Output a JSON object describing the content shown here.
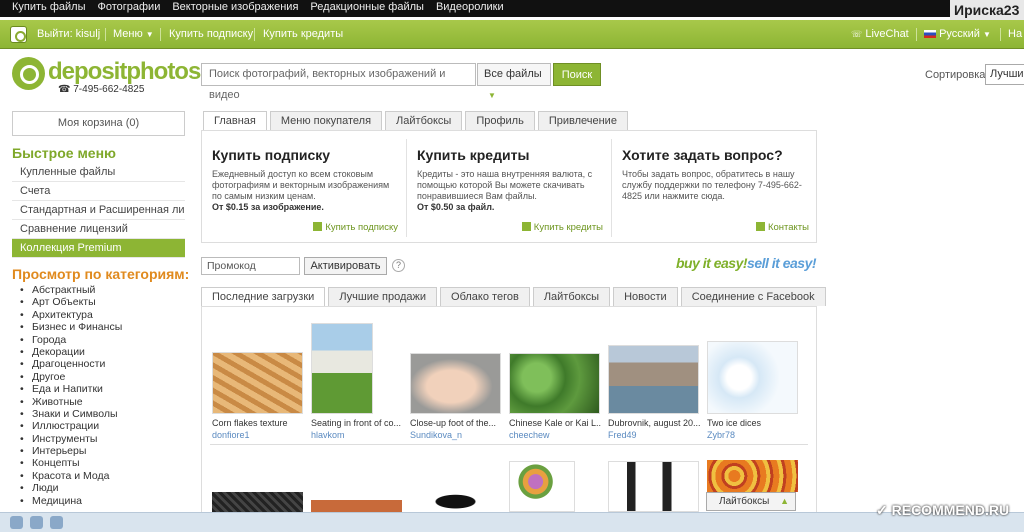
{
  "topnav": [
    "Купить файлы",
    "Фотографии",
    "Векторные изображения",
    "Редакционные файлы",
    "Видеоролики"
  ],
  "username_badge": "Ириска23",
  "greenbar": {
    "logout": "Выйти: kisulj",
    "menu": "Меню",
    "buy_sub": "Купить подписку",
    "buy_credits": "Купить кредиты",
    "livechat": "LiveChat",
    "language": "Русский",
    "next": "На"
  },
  "logo": {
    "text": "depositphotos",
    "phone": "7-495-662-4825"
  },
  "search": {
    "placeholder": "Поиск фотографий, векторных изображений и видео",
    "filter": "Все файлы",
    "button": "Поиск"
  },
  "sort": {
    "label": "Сортировка",
    "value": "Лучши"
  },
  "cart": "Моя корзина (0)",
  "quick_menu_title": "Быстрое меню",
  "quick_menu": [
    "Купленные файлы",
    "Счета",
    "Стандартная и Расширенная лиц...",
    "Сравнение лицензий",
    "Коллекция Premium"
  ],
  "categories_title": "Просмотр по категориям:",
  "categories": [
    "Абстрактный",
    "Арт Объекты",
    "Архитектура",
    "Бизнес и Финансы",
    "Города",
    "Декорации",
    "Драгоценности",
    "Другое",
    "Еда и Напитки",
    "Животные",
    "Знаки и Символы",
    "Иллюстрации",
    "Инструменты",
    "Интерьеры",
    "Концепты",
    "Красота и Мода",
    "Люди",
    "Медицина"
  ],
  "main_tabs": [
    "Главная",
    "Меню покупателя",
    "Лайтбоксы",
    "Профиль",
    "Привлечение"
  ],
  "panel": {
    "sub": {
      "title": "Купить подписку",
      "text": "Ежедневный доступ ко всем стоковым фотографиям и векторным изображениям по самым низким ценам.",
      "price": "От $0.15 за изображение.",
      "link": "Купить подписку"
    },
    "credits": {
      "title": "Купить кредиты",
      "text": "Кредиты - это наша внутренняя валюта, с помощью которой Вы можете скачивать понравившиеся Вам файлы.",
      "price": "От $0.50 за файл.",
      "link": "Купить кредиты"
    },
    "question": {
      "title": "Хотите задать вопрос?",
      "text": "Чтобы задать вопрос, обратитесь в нашу службу поддержки по телефону 7-495-662-4825 или нажмите сюда.",
      "link": "Контакты"
    }
  },
  "promo": {
    "placeholder": "Промокод",
    "button": "Активировать",
    "help": "?"
  },
  "slogan": {
    "a": "buy it easy!",
    "b": "sell it easy!"
  },
  "gallery_tabs": [
    "Последние загрузки",
    "Лучшие продажи",
    "Облако тегов",
    "Лайтбоксы",
    "Новости",
    "Соединение с Facebook"
  ],
  "thumbs": [
    {
      "caption": "Corn flakes texture",
      "author": "donfiore1",
      "color": "#d9a060"
    },
    {
      "caption": "Seating in front of co...",
      "author": "hlavkom",
      "color": "#6a9a3a"
    },
    {
      "caption": "Close-up foot of the...",
      "author": "Sundikova_n",
      "color": "#e8c2a8"
    },
    {
      "caption": "Chinese Kale or Kai L...",
      "author": "cheechew",
      "color": "#4e8a3a"
    },
    {
      "caption": "Dubrovnik, august 20...",
      "author": "Fred49",
      "color": "#8a8a7a"
    },
    {
      "caption": "Two ice dices",
      "author": "Zybr78",
      "color": "#cfe2f2"
    }
  ],
  "lightbox_bar": "Лайтбоксы",
  "watermark": "✓ RECOMMEND.RU"
}
